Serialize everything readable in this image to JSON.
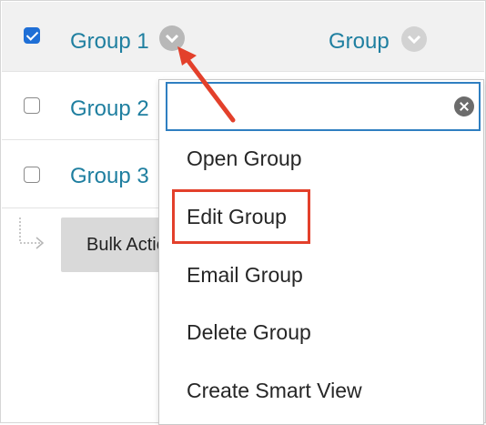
{
  "table": {
    "header_column_label": "Group",
    "rows": [
      {
        "label": "Group 1",
        "checked": true
      },
      {
        "label": "Group 2",
        "checked": false
      },
      {
        "label": "Group 3",
        "checked": false
      }
    ]
  },
  "bulk_actions": {
    "label": "Bulk Actions"
  },
  "menu": {
    "search_value": "",
    "items": [
      {
        "label": "Open Group"
      },
      {
        "label": "Edit Group",
        "highlighted": true
      },
      {
        "label": "Email Group"
      },
      {
        "label": "Delete Group"
      },
      {
        "label": "Create Smart View"
      }
    ]
  },
  "colors": {
    "link": "#1f7fa0",
    "checkbox_checked": "#1f6fd6",
    "search_border": "#2f7fc1",
    "annotation": "#e3402b"
  },
  "icons": {
    "row_menu": "chevron-down-icon",
    "clear": "clear-circle-icon",
    "bulk_elbow": "elbow-arrow-icon",
    "annotation": "red-arrow-icon"
  }
}
